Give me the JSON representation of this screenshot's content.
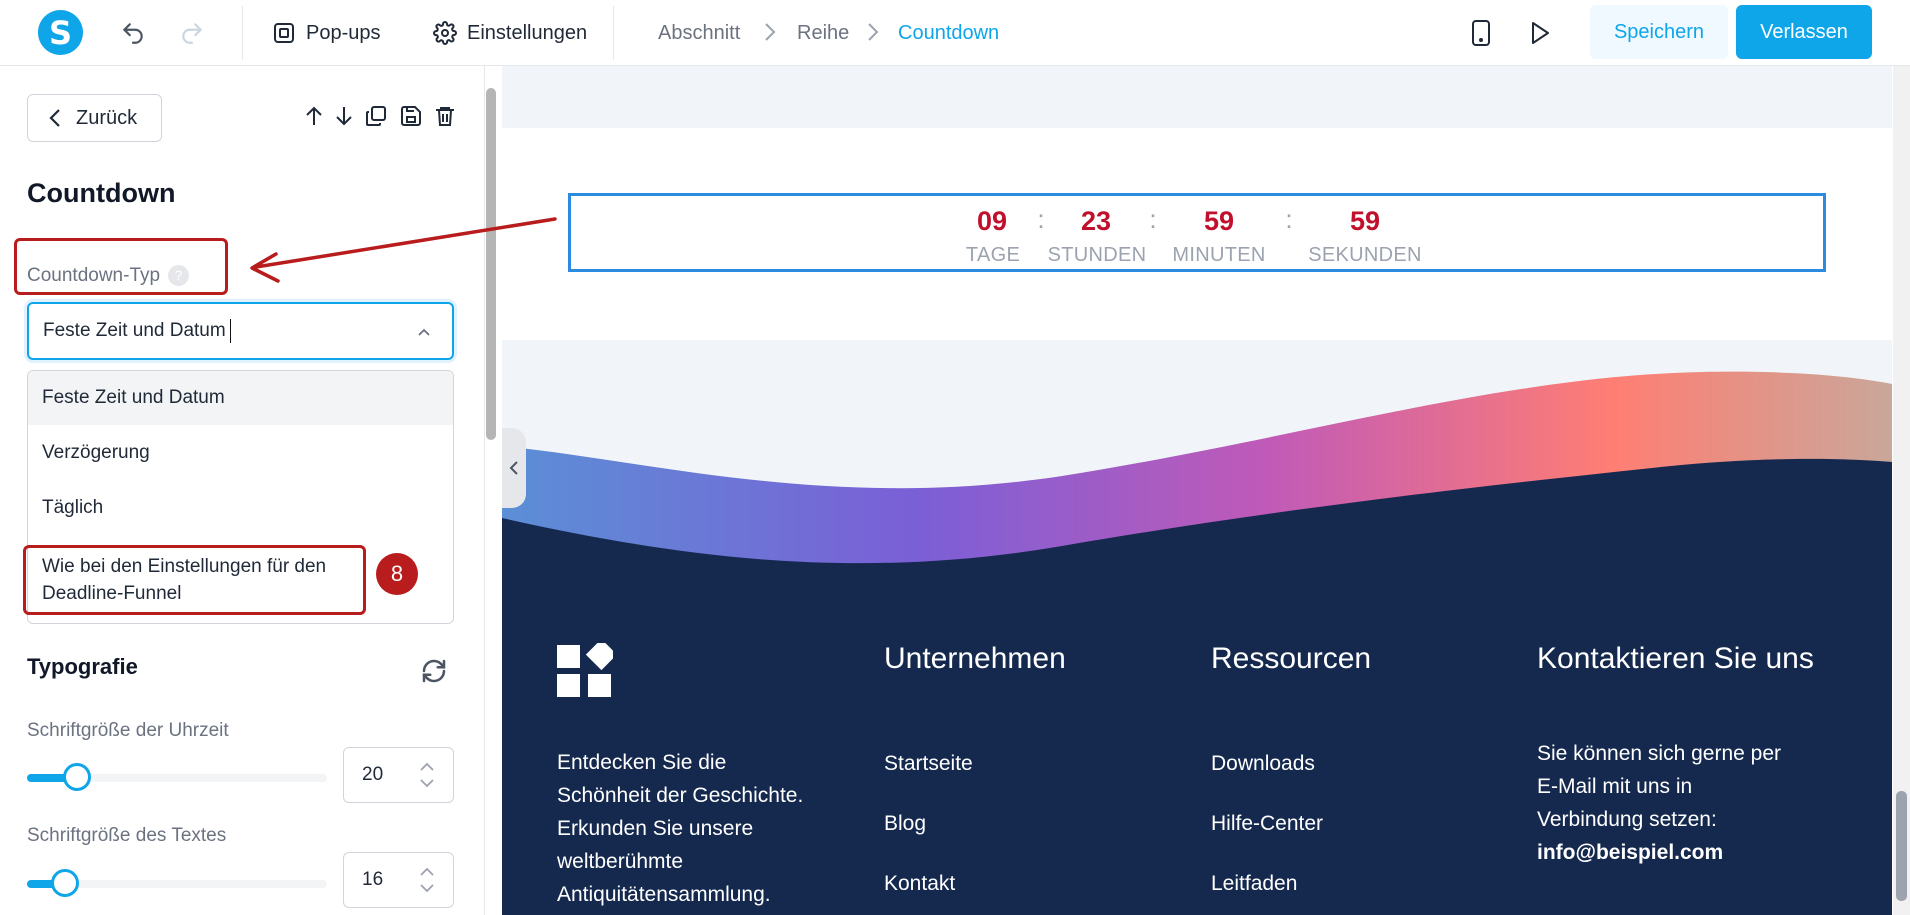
{
  "topbar": {
    "logo_letter": "S",
    "popups_label": "Pop-ups",
    "settings_label": "Einstellungen",
    "breadcrumb": [
      "Abschnitt",
      "Reihe",
      "Countdown"
    ],
    "save_label": "Speichern",
    "exit_label": "Verlassen"
  },
  "sidebar": {
    "back_label": "Zurück",
    "title": "Countdown",
    "type_label": "Countdown-Typ",
    "help_glyph": "?",
    "selected_value": "Feste Zeit und Datum",
    "options": [
      "Feste Zeit und Datum",
      "Verzögerung",
      "Täglich",
      "Wie bei den Einstellungen für den",
      "Deadline-Funnel"
    ],
    "step_badge": "8",
    "typography_title": "Typografie",
    "time_size_label": "Schriftgröße der Uhrzeit",
    "time_size_value": "20",
    "time_size_fraction": 0.16,
    "text_size_label": "Schriftgröße des Textes",
    "text_size_value": "16",
    "text_size_fraction": 0.12
  },
  "countdown": {
    "values": [
      "09",
      "23",
      "59",
      "59"
    ],
    "labels": [
      "TAGE",
      "STUNDEN",
      "MINUTEN",
      "SEKUNDEN"
    ],
    "separator": ":"
  },
  "footer": {
    "company_heading": "Unternehmen",
    "resources_heading": "Ressourcen",
    "contact_heading": "Kontaktieren Sie uns",
    "about_lines": [
      "Entdecken Sie die",
      "Schönheit der Geschichte.",
      "Erkunden Sie unsere",
      "weltberühmte",
      "Antiquitätensammlung."
    ],
    "company_links": [
      "Startseite",
      "Blog",
      "Kontakt"
    ],
    "resource_links": [
      "Downloads",
      "Hilfe-Center",
      "Leitfaden"
    ],
    "contact_lines": [
      "Sie können sich gerne per",
      "E-Mail mit uns in",
      "Verbindung setzen:"
    ],
    "contact_email": "info@beispiel.com"
  },
  "colors": {
    "accent": "#0ea5e9",
    "annotation_red": "#b91c1c",
    "countdown_red": "#c0102c",
    "footer_navy": "#15294f"
  }
}
